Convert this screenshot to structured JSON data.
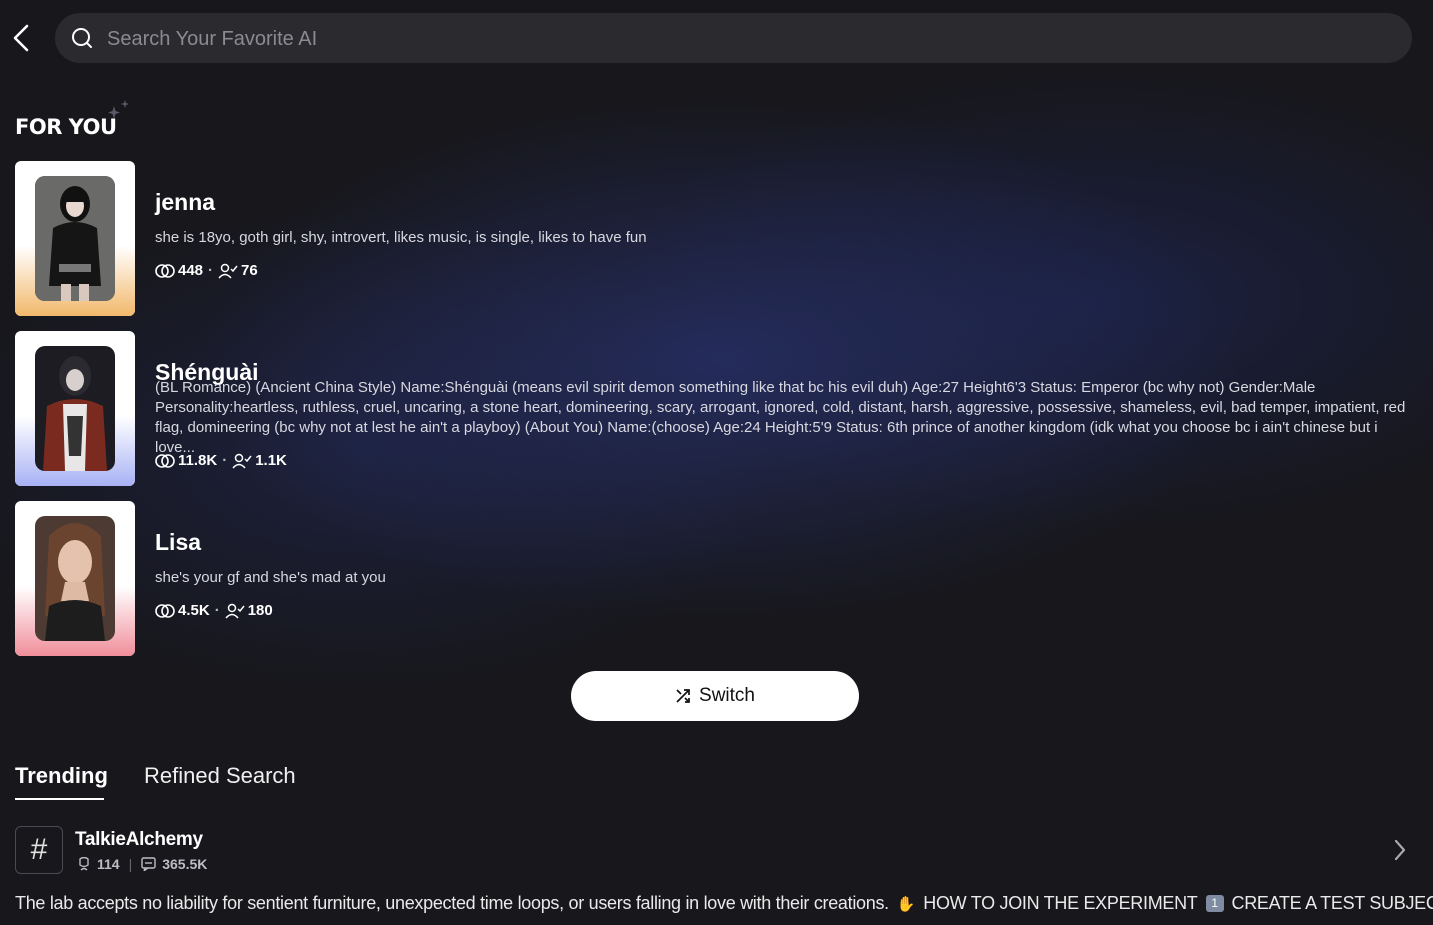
{
  "search": {
    "placeholder": "Search Your Favorite AI"
  },
  "for_you": {
    "title": "FOR YOU",
    "cards": [
      {
        "name": "jenna",
        "description": "she is 18yo, goth girl, shy, introvert, likes music, is single, likes to have fun",
        "chats": "448",
        "followers": "76",
        "accent": "#f2b96b"
      },
      {
        "name": "Shénguài",
        "description": "(BL Romance) (Ancient China Style) Name:Shénguài (means evil spirit demon something like that bc his evil duh) Age:27 Height6'3 Status: Emperor (bc why not) Gender:Male Personality:heartless, ruthless, cruel, uncaring, a stone heart, domineering, scary, arrogant, ignored, cold, distant, harsh, aggressive, possessive, shameless, evil, bad temper, impatient, red flag, domineering (bc why not at lest he ain't a playboy) (About You) Name:(choose) Age:24 Height:5'9 Status: 6th prince of another kingdom (idk what you choose bc i ain't chinese but i love...",
        "chats": "11.8K",
        "followers": "1.1K",
        "accent": "#a8b2f5"
      },
      {
        "name": "Lisa",
        "description": "she's your gf and she's mad at you",
        "chats": "4.5K",
        "followers": "180",
        "accent": "#f08f9b"
      }
    ]
  },
  "switch": {
    "label": "Switch"
  },
  "tabs": {
    "trending": "Trending",
    "refined": "Refined Search"
  },
  "trending": {
    "tag": {
      "name": "TalkieAlchemy",
      "characters": "114",
      "chats": "365.5K"
    },
    "ticker": {
      "part1": "The lab accepts no liability for sentient furniture, unexpected time loops, or users falling in love with their creations.",
      "emoji1": "✋",
      "part2": "HOW TO JOIN THE EXPERIMENT",
      "keycap": "1",
      "part3": "CREATE A TEST SUBJECT -"
    }
  }
}
